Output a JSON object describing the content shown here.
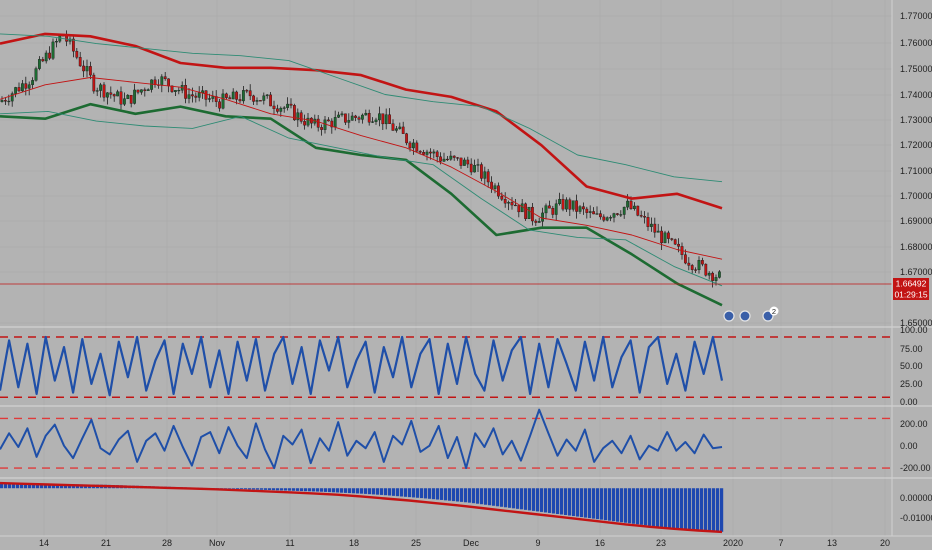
{
  "chart_data": [
    {
      "type": "candlestick",
      "ylim": [
        1.645,
        1.78
      ],
      "yticks": [
        "1.77000",
        "1.76000",
        "1.75000",
        "1.74000",
        "1.73000",
        "1.72000",
        "1.71000",
        "1.70000",
        "1.69000",
        "1.68000",
        "1.67000",
        "1.65000"
      ],
      "last_price": "1.66492",
      "countdown": "01:29:15",
      "series": [
        {
          "kind": "bb_upper",
          "color": "#c21414",
          "values": [
            1.762,
            1.766,
            1.765,
            1.761,
            1.754,
            1.752,
            1.752,
            1.751,
            1.749,
            1.743,
            1.74,
            1.734,
            1.72,
            1.703,
            1.698,
            1.7,
            1.694
          ]
        },
        {
          "kind": "bb_middle",
          "color": "#c21414",
          "values": [
            1.739,
            1.745,
            1.748,
            1.746,
            1.744,
            1.739,
            1.733,
            1.73,
            1.724,
            1.719,
            1.711,
            1.701,
            1.69,
            1.687,
            1.683,
            1.677,
            1.673
          ]
        },
        {
          "kind": "bb_lower",
          "color": "#1d6b32",
          "values": [
            1.732,
            1.731,
            1.737,
            1.733,
            1.736,
            1.732,
            1.731,
            1.719,
            1.716,
            1.714,
            1.7,
            1.683,
            1.686,
            1.686,
            1.675,
            1.663,
            1.654
          ]
        },
        {
          "kind": "ma_long",
          "color": "#2e8b74",
          "values": [
            1.766,
            1.765,
            1.762,
            1.76,
            1.758,
            1.757,
            1.755,
            1.748,
            1.741,
            1.738,
            1.736,
            1.727,
            1.716,
            1.712,
            1.707,
            1.705
          ]
        },
        {
          "kind": "ma_lower_thin",
          "color": "#2e8b74",
          "values": [
            1.733,
            1.734,
            1.73,
            1.728,
            1.727,
            1.732,
            1.723,
            1.719,
            1.715,
            1.712,
            1.698,
            1.685,
            1.682,
            1.681,
            1.67,
            1.662
          ]
        }
      ],
      "event_markers": [
        {
          "label": ""
        },
        {
          "label": ""
        },
        {
          "label": "2"
        }
      ]
    },
    {
      "type": "line",
      "ylim": [
        0,
        100
      ],
      "yticks": [
        "100.00",
        "75.00",
        "50.00",
        "25.00",
        "0.00"
      ],
      "hlines": [
        95,
        5
      ],
      "series": [
        {
          "color": "#1f4fa8",
          "values": [
            15,
            90,
            20,
            85,
            10,
            95,
            30,
            80,
            12,
            92,
            25,
            70,
            8,
            88,
            35,
            95,
            15,
            60,
            90,
            10,
            85,
            40,
            95,
            20,
            75,
            10,
            88,
            30,
            92,
            15,
            70,
            95,
            25,
            80,
            10,
            90,
            45,
            95,
            20,
            60,
            88,
            12,
            80,
            35,
            95,
            20,
            70,
            92,
            10,
            85,
            25,
            95,
            40,
            15,
            90,
            30,
            75,
            95,
            10,
            85,
            20,
            92,
            55,
            15,
            88,
            30,
            95,
            20,
            65,
            90,
            12,
            80,
            95,
            25,
            70,
            15,
            88,
            40,
            95,
            30
          ]
        }
      ]
    },
    {
      "type": "line",
      "ylim": [
        -280,
        300
      ],
      "yticks": [
        "200.00",
        "0.00",
        "-200.00"
      ],
      "hlines": [
        200,
        -200
      ],
      "series": [
        {
          "color": "#1f4fa8",
          "values": [
            -50,
            80,
            -30,
            120,
            -110,
            60,
            150,
            -20,
            -120,
            40,
            190,
            -40,
            -90,
            30,
            100,
            -150,
            20,
            80,
            -60,
            140,
            -30,
            -180,
            50,
            90,
            -80,
            130,
            -20,
            -120,
            160,
            -50,
            -200,
            60,
            -10,
            110,
            -160,
            40,
            -60,
            170,
            -100,
            20,
            -40,
            90,
            -150,
            60,
            -10,
            180,
            -70,
            -20,
            140,
            -120,
            50,
            -200,
            80,
            -30,
            120,
            -90,
            20,
            -140,
            60,
            270,
            80,
            -100,
            30,
            -60,
            110,
            -150,
            -40,
            20,
            -80,
            60,
            -130,
            -20,
            -60,
            90,
            -60,
            10,
            -80,
            70,
            -40,
            -30
          ]
        }
      ]
    },
    {
      "type": "bar",
      "ylim": [
        -0.014,
        0.003
      ],
      "yticks": [
        "0.00000",
        "-0.01000"
      ],
      "series": [
        {
          "kind": "histogram",
          "color": "#1e48b0",
          "values": [
            0.0015,
            0.0014,
            0.0013,
            0.0012,
            0.0011,
            0.001,
            0.0008,
            0.0006,
            0.0004,
            0.0002,
            0,
            -0.0002,
            -0.0004,
            -0.0006,
            -0.0008,
            -0.001,
            -0.0013,
            -0.0016,
            -0.002,
            -0.0025,
            -0.003,
            -0.0036,
            -0.0042,
            -0.005,
            -0.0058,
            -0.0066,
            -0.0074,
            -0.0082,
            -0.009,
            -0.0098,
            -0.0106,
            -0.0114,
            -0.012,
            -0.0125,
            -0.0128
          ]
        },
        {
          "kind": "signal",
          "color": "#c21414",
          "values": [
            0.0015,
            0.0013,
            0.0011,
            0.0009,
            0.0007,
            0.0005,
            0.0003,
            0.0001,
            -0.0001,
            -0.0003,
            -0.0006,
            -0.0009,
            -0.0012,
            -0.0015,
            -0.0019,
            -0.0024,
            -0.003,
            -0.0036,
            -0.0043,
            -0.005,
            -0.0058,
            -0.0066,
            -0.0074,
            -0.0082,
            -0.009,
            -0.0098,
            -0.0106,
            -0.0113,
            -0.0119,
            -0.0124,
            -0.0128
          ]
        }
      ]
    }
  ],
  "x_axis": {
    "labels": [
      "14",
      "21",
      "28",
      "Nov",
      "11",
      "18",
      "25",
      "Dec",
      "9",
      "16",
      "23",
      "2020",
      "7",
      "13",
      "20"
    ]
  },
  "colors": {
    "background": "#b3b3b3",
    "price_tag": "#c21414",
    "grid": "#a6a6a6",
    "up_candle": "#1d6b32",
    "down_candle": "#c21414"
  }
}
